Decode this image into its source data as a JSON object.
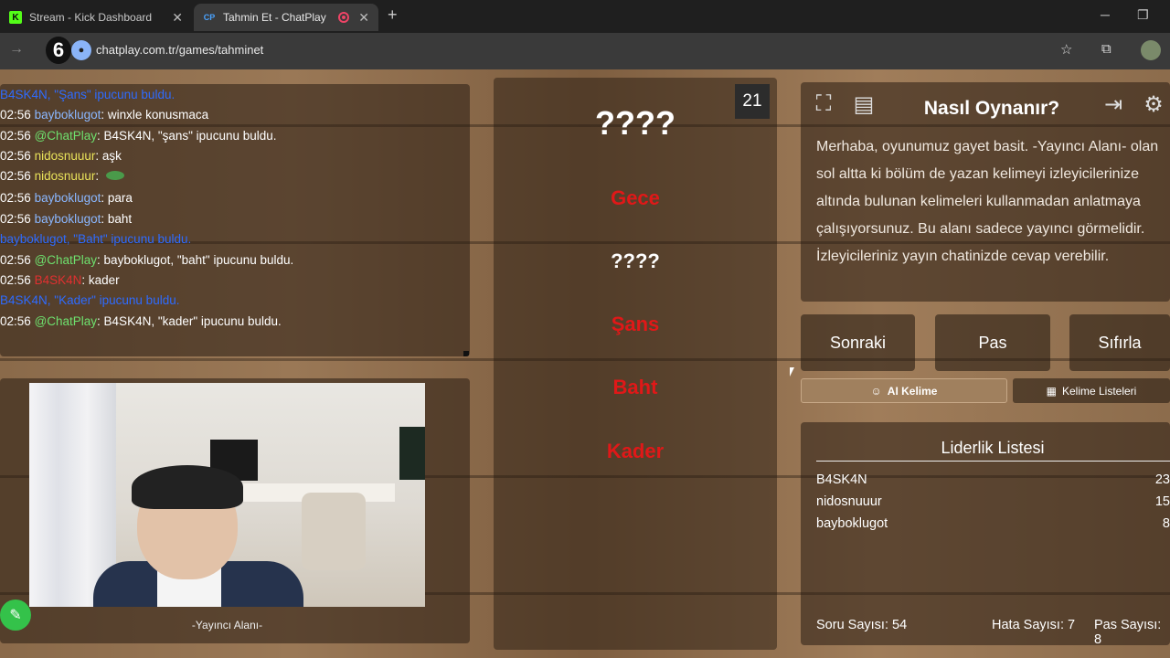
{
  "browser": {
    "tabs": [
      {
        "title": "Stream - Kick Dashboard",
        "favicon": "K"
      },
      {
        "title": "Tahmin Et - ChatPlay",
        "favicon": "CP"
      }
    ],
    "badge": "6",
    "url": "chatplay.com.tr/games/tahminet"
  },
  "chat": {
    "lines": [
      {
        "time": "",
        "user": "",
        "text": "B4SK4N, \"Şans\" ipucunu buldu.",
        "type": "system"
      },
      {
        "time": "02:56",
        "user": "bayboklugot",
        "text": ": winxle konusmaca",
        "type": "blue"
      },
      {
        "time": "02:56",
        "user": "@ChatPlay",
        "text": ": B4SK4N, \"şans\" ipucunu buldu.",
        "type": "green"
      },
      {
        "time": "02:56",
        "user": "nidosnuuur",
        "text": ": aşk",
        "type": "yellow"
      },
      {
        "time": "02:56",
        "user": "nidosnuuur",
        "text": ":",
        "type": "yellow"
      },
      {
        "time": "02:56",
        "user": "bayboklugot",
        "text": ": para",
        "type": "blue"
      },
      {
        "time": "02:56",
        "user": "bayboklugot",
        "text": ": baht",
        "type": "blue"
      },
      {
        "time": "",
        "user": "",
        "text": "bayboklugot, \"Baht\" ipucunu buldu.",
        "type": "system"
      },
      {
        "time": "02:56",
        "user": "@ChatPlay",
        "text": ": bayboklugot, \"baht\" ipucunu buldu.",
        "type": "green"
      },
      {
        "time": "02:56",
        "user": "B4SK4N",
        "text": ": kader",
        "type": "red"
      },
      {
        "time": "",
        "user": "",
        "text": "B4SK4N, \"Kader\" ipucunu buldu.",
        "type": "system"
      },
      {
        "time": "02:56",
        "user": "@ChatPlay",
        "text": ": B4SK4N, \"kader\" ipucunu buldu.",
        "type": "green"
      }
    ]
  },
  "streamer": {
    "label": "-Yayıncı Alanı-"
  },
  "game": {
    "counter": "21",
    "words": [
      {
        "text": "????",
        "style": "hidden-large"
      },
      {
        "text": "Gece",
        "style": "found"
      },
      {
        "text": "????",
        "style": "hidden"
      },
      {
        "text": "Şans",
        "style": "found"
      },
      {
        "text": "Baht",
        "style": "found"
      },
      {
        "text": "Kader",
        "style": "found"
      }
    ]
  },
  "info": {
    "title": "Nasıl Oynanır?",
    "text": "Merhaba, oyunumuz gayet basit. -Yayıncı Alanı- olan sol altta ki bölüm de yazan kelimeyi izleyicilerinize altında bulunan kelimeleri kullanmadan anlatmaya çalışıyorsunuz. Bu alanı sadece yayıncı görmelidir. İzleyicileriniz yayın chatinizde cevap verebilir."
  },
  "controls": {
    "next": "Sonraki",
    "pass": "Pas",
    "reset": "Sıfırla",
    "ai_word": "AI Kelime",
    "word_lists": "Kelime Listeleri"
  },
  "leaderboard": {
    "title": "Liderlik Listesi",
    "rows": [
      {
        "name": "B4SK4N",
        "score": "23"
      },
      {
        "name": "nidosnuuur",
        "score": "15"
      },
      {
        "name": "bayboklugot",
        "score": "8"
      }
    ],
    "questions": "Soru Sayısı: 54",
    "errors": "Hata Sayısı: 7",
    "passes": "Pas Sayısı: 8"
  },
  "colors": {
    "found_word": "#e01818",
    "system_msg": "#2e6bff",
    "accent_green": "#34c24a"
  }
}
